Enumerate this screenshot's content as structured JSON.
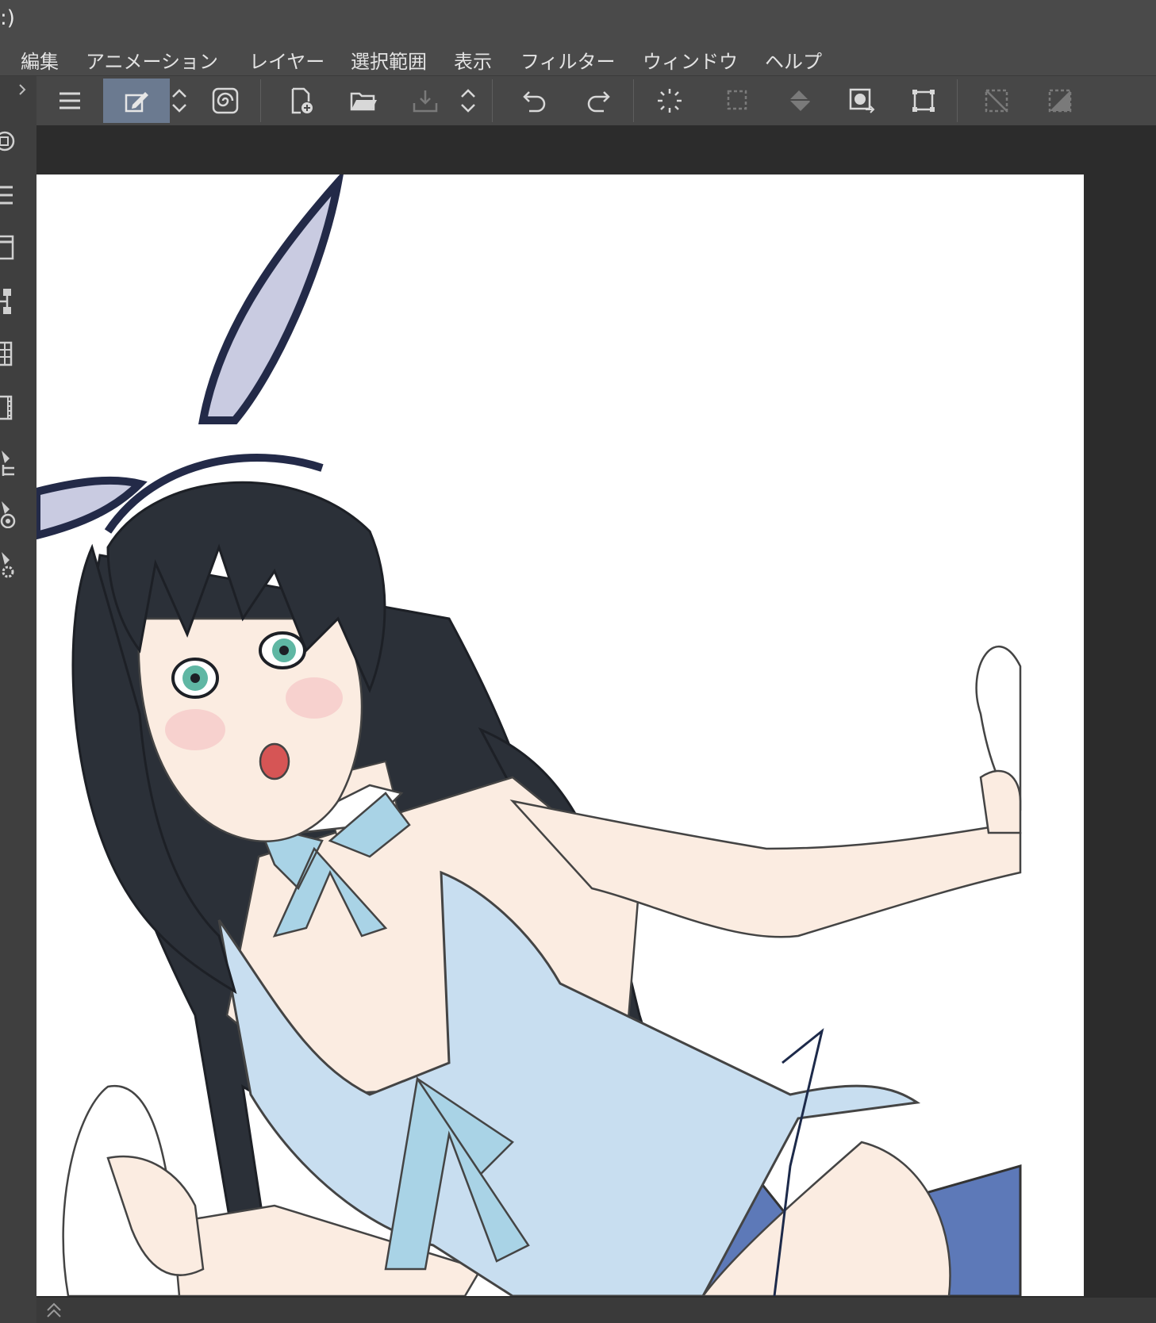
{
  "titlebar": {
    "title_fragment": ":)"
  },
  "menu": {
    "items": [
      "編集",
      "アニメーション",
      "レイヤー",
      "選択範囲",
      "表示",
      "フィルター",
      "ウィンドウ",
      "ヘルプ"
    ]
  },
  "toolbar": {
    "buttons": [
      {
        "icon": "hamburger-menu-icon"
      },
      {
        "icon": "edit-tool-icon",
        "active": true
      },
      {
        "icon": "up-down-chevron-icon"
      },
      {
        "icon": "swirl-icon"
      },
      {
        "icon": "new-file-icon"
      },
      {
        "icon": "open-folder-icon"
      },
      {
        "icon": "save-icon",
        "disabled": true
      },
      {
        "icon": "up-down-chevron-icon"
      },
      {
        "icon": "undo-icon"
      },
      {
        "icon": "redo-icon"
      },
      {
        "icon": "loading-spinner-icon"
      },
      {
        "icon": "selection-marquee-icon",
        "disabled": true
      },
      {
        "icon": "fill-bucket-icon",
        "disabled": true
      },
      {
        "icon": "selection-swap-icon"
      },
      {
        "icon": "transform-icon"
      },
      {
        "icon": "clear-selection-icon",
        "disabled": true
      },
      {
        "icon": "invert-selection-icon",
        "disabled": true
      }
    ]
  },
  "left_rail": {
    "icons": [
      "layer-panel-icon",
      "list-panel-icon",
      "window-panel-icon",
      "node-panel-icon",
      "grid-panel-icon",
      "timeline-panel-icon",
      "brush-tree-icon",
      "brush-target-icon",
      "brush-settings-icon"
    ]
  },
  "colors": {
    "chrome": "#4a4a4a",
    "background": "#2c2c2c",
    "active_button": "#6b7a90",
    "canvas": "#ffffff",
    "hair": "#2b3038",
    "dress": "#c8def0",
    "leotard": "#5d79b8",
    "skin": "#fbece1",
    "ribbon": "#a9d3e6",
    "ear_inner": "#c9cbe1"
  }
}
